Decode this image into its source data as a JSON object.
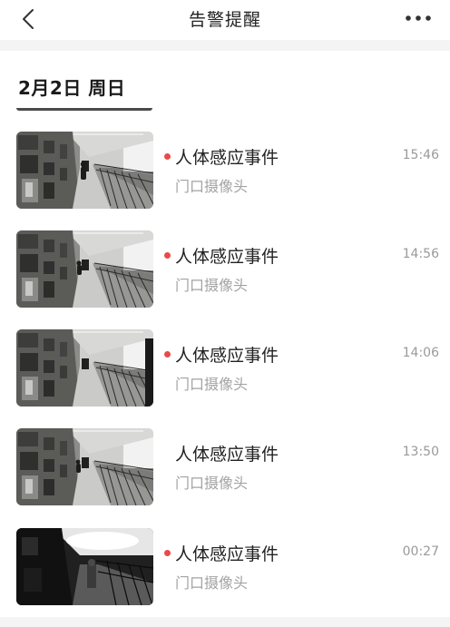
{
  "header": {
    "title": "告警提醒",
    "back_icon": "chevron-left-icon",
    "more_icon": "more-horizontal-icon"
  },
  "main": {
    "date_label": "2月2日 周日",
    "events": [
      {
        "title": "人体感应事件",
        "camera": "门口摄像头",
        "time": "15:46",
        "unread": true,
        "night": false
      },
      {
        "title": "人体感应事件",
        "camera": "门口摄像头",
        "time": "14:56",
        "unread": true,
        "night": false
      },
      {
        "title": "人体感应事件",
        "camera": "门口摄像头",
        "time": "14:06",
        "unread": true,
        "night": false
      },
      {
        "title": "人体感应事件",
        "camera": "门口摄像头",
        "time": "13:50",
        "unread": false,
        "night": false
      },
      {
        "title": "人体感应事件",
        "camera": "门口摄像头",
        "time": "00:27",
        "unread": true,
        "night": true
      }
    ]
  },
  "colors": {
    "unread_dot": "#e84a4a",
    "title_text": "#222222",
    "secondary_text": "#a3a3a3",
    "background": "#f4f4f4"
  }
}
